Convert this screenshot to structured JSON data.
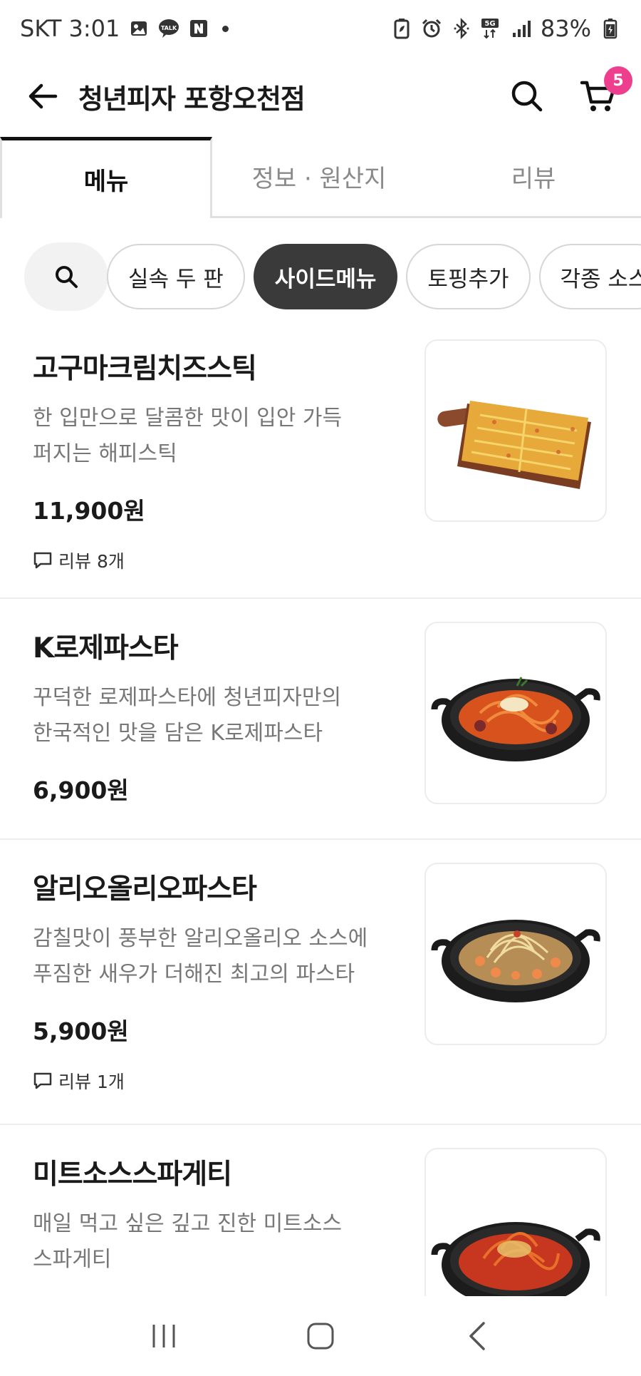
{
  "status_bar": {
    "carrier_time": "SKT 3:01",
    "battery": "83%"
  },
  "header": {
    "title": "청년피자 포항오천점",
    "cart_count": "5"
  },
  "tabs": [
    {
      "label": "메뉴"
    },
    {
      "label": "정보 · 원산지"
    },
    {
      "label": "리뷰"
    }
  ],
  "chips": [
    {
      "label": "실속 두 판"
    },
    {
      "label": "사이드메뉴"
    },
    {
      "label": "토핑추가"
    },
    {
      "label": "각종 소스"
    }
  ],
  "menu": [
    {
      "name": "고구마크림치즈스틱",
      "desc_line1": "한 입만으로 달콤한 맛이 입안 가득",
      "desc_line2": "퍼지는 해피스틱",
      "price": "11,900원",
      "reviews": "리뷰 8개",
      "image": "cheese-stick-board"
    },
    {
      "name": "K로제파스타",
      "desc_line1": "꾸덕한 로제파스타에 청년피자만의",
      "desc_line2": "한국적인 맛을 담은 K로제파스타",
      "price": "6,900원",
      "image": "rose-pasta-pan"
    },
    {
      "name": "알리오올리오파스타",
      "desc_line1": "감칠맛이 풍부한 알리오올리오 소스에",
      "desc_line2": "푸짐한 새우가 더해진 최고의 파스타",
      "price": "5,900원",
      "reviews": "리뷰 1개",
      "image": "aglio-olio-pan"
    },
    {
      "name": "미트소스스파게티",
      "desc_line1": "매일 먹고 싶은 깊고 진한 미트소스",
      "desc_line2": "스파게티",
      "image": "meat-sauce-pan"
    }
  ],
  "colors": {
    "accent_badge": "#ee3e8e",
    "chip_active": "#3a3a3a"
  }
}
